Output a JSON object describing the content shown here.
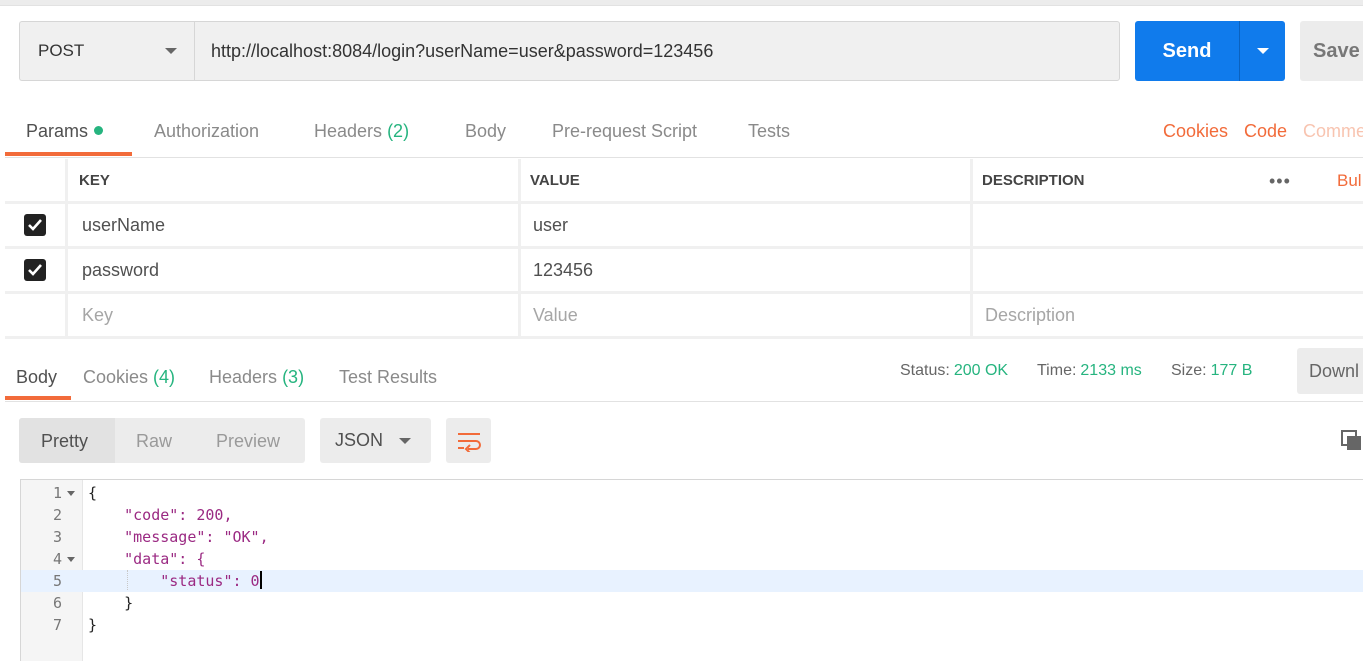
{
  "request": {
    "method": "POST",
    "url": "http://localhost:8084/login?userName=user&password=123456",
    "send_label": "Send",
    "save_label": "Save"
  },
  "request_tabs": [
    {
      "label": "Params",
      "count": ""
    },
    {
      "label": "Authorization",
      "count": ""
    },
    {
      "label": "Headers",
      "count": "(2)"
    },
    {
      "label": "Body",
      "count": ""
    },
    {
      "label": "Pre-request Script",
      "count": ""
    },
    {
      "label": "Tests",
      "count": ""
    }
  ],
  "right_links": {
    "cookies": "Cookies",
    "code": "Code",
    "comments": "Comme"
  },
  "params": {
    "headers": {
      "key": "KEY",
      "value": "VALUE",
      "description": "DESCRIPTION",
      "more": "•••",
      "bulk": "Bul"
    },
    "rows": [
      {
        "key": "userName",
        "value": "user",
        "description": "",
        "checked": true
      },
      {
        "key": "password",
        "value": "123456",
        "description": "",
        "checked": true
      }
    ],
    "placeholder": {
      "key": "Key",
      "value": "Value",
      "description": "Description"
    }
  },
  "response_tabs": [
    {
      "label": "Body",
      "count": ""
    },
    {
      "label": "Cookies",
      "count": "(4)"
    },
    {
      "label": "Headers",
      "count": "(3)"
    },
    {
      "label": "Test Results",
      "count": ""
    }
  ],
  "status": {
    "status_label": "Status:",
    "status_value": "200 OK",
    "time_label": "Time:",
    "time_value": "2133 ms",
    "size_label": "Size:",
    "size_value": "177 B",
    "download_label": "Downl"
  },
  "view": {
    "pretty": "Pretty",
    "raw": "Raw",
    "preview": "Preview",
    "format": "JSON"
  },
  "code_lines": [
    {
      "no": "1",
      "fold": true,
      "text": "{"
    },
    {
      "no": "2",
      "fold": false,
      "text": "    \"code\": 200,"
    },
    {
      "no": "3",
      "fold": false,
      "text": "    \"message\": \"OK\","
    },
    {
      "no": "4",
      "fold": true,
      "text": "    \"data\": {"
    },
    {
      "no": "5",
      "fold": false,
      "text": "        \"status\": 0"
    },
    {
      "no": "6",
      "fold": false,
      "text": "    }"
    },
    {
      "no": "7",
      "fold": false,
      "text": "}"
    }
  ],
  "colors": {
    "accent": "#f26b3a",
    "send": "#107bec",
    "success": "#26b47f"
  }
}
